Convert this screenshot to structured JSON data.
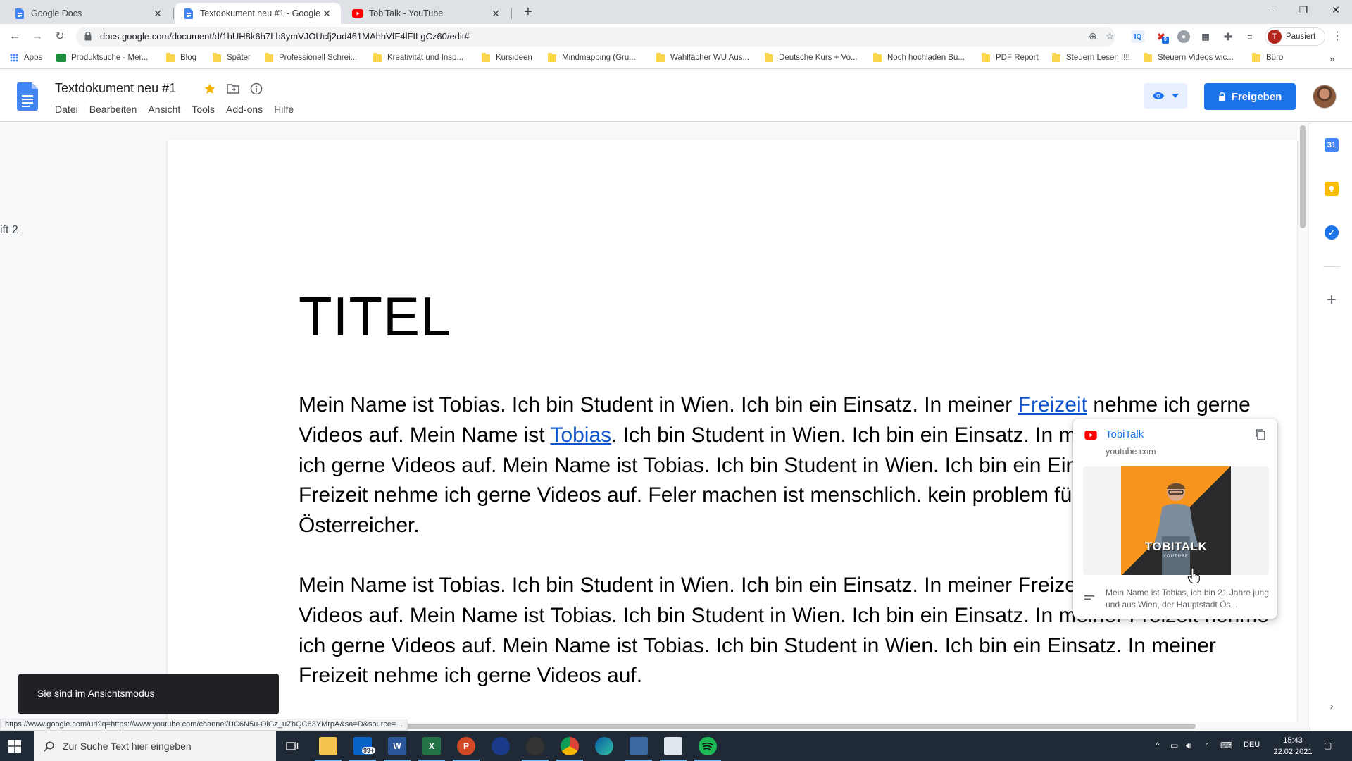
{
  "browser": {
    "tabs": [
      {
        "title": "Google Docs",
        "icon": "google-docs-icon"
      },
      {
        "title": "Textdokument neu #1 - Google Docs",
        "icon": "google-docs-icon"
      },
      {
        "title": "TobiTalk - YouTube",
        "icon": "youtube-icon"
      }
    ],
    "url": "docs.google.com/document/d/1hUH8k6h7Lb8ymVJOUcfj2ud461MAhhVfF4lFILgCz60/edit#",
    "profile_status": "Pausiert",
    "profile_initial": "T",
    "extension_badge": "0",
    "bookmarks": [
      "Apps",
      "Produktsuche - Mer...",
      "Blog",
      "Später",
      "Professionell Schrei...",
      "Kreativität und Insp...",
      "Kursideen",
      "Mindmapping  (Gru...",
      "Wahlfächer WU Aus...",
      "Deutsche Kurs + Vo...",
      "Noch hochladen Bu...",
      "PDF Report",
      "Steuern Lesen !!!!",
      "Steuern Videos wic...",
      "Büro"
    ]
  },
  "docs": {
    "title": "Textdokument neu #1",
    "menu": [
      "Datei",
      "Bearbeiten",
      "Ansicht",
      "Tools",
      "Add-ons",
      "Hilfe"
    ],
    "share_label": "Freigeben",
    "outline_fragment": "ift 2",
    "document": {
      "heading": "TITEL",
      "p1": {
        "s1": "Mein Name ist Tobias. Ich bin Student in Wien. Ich bin ein Einsatz. In meiner ",
        "link1": "Freizeit",
        "s2": " nehme ich gerne Videos auf. Mein Name ist ",
        "link2": "Tobias",
        "s3": ". Ich bin Student in Wien. Ich bin ein Einsatz. In meiner Freizeit nehme ich gerne Videos auf. Mein Name ist Tobias. Ich bin Student in Wien. Ich bin ein Einsatz. In meiner Freizeit nehme ich gerne Videos auf. Feler machen ist menschlich. kein problem für mich. Ich bim Österreicher."
      },
      "p2": "Mein Name ist Tobias. Ich bin Student in Wien. Ich bin ein Einsatz. In meiner Freizeit nehme ich gerne Videos auf. Mein Name ist Tobias. Ich bin Student in Wien. Ich bin ein Einsatz. In meiner Freizeit nehme ich gerne Videos auf. Mein Name ist Tobias. Ich bin Student in Wien. Ich bin ein Einsatz. In meiner Freizeit nehme ich gerne Videos auf."
    },
    "link_preview": {
      "title": "TobiTalk",
      "domain": "youtube.com",
      "thumbnail_brand": "TOBITALK",
      "thumbnail_sub": "YOUTUBE",
      "description": "Mein Name ist Tobias, ich bin 21 Jahre jung und aus Wien, der Hauptstadt Ös..."
    },
    "toast": "Sie sind im Ansichtsmodus"
  },
  "status_link": "https://www.google.com/url?q=https://www.youtube.com/channel/UC6N5u-OiGz_uZbQC63YMrpA&sa=D&source=...",
  "taskbar": {
    "search_placeholder": "Zur Suche Text hier eingeben",
    "mail_badge": "99+",
    "language": "DEU",
    "time": "15:43",
    "date": "22.02.2021"
  },
  "colors": {
    "accent": "#1a73e8",
    "link": "#1155cc",
    "taskbar": "#1f2a36",
    "thumbnail_orange": "#f7941d"
  }
}
